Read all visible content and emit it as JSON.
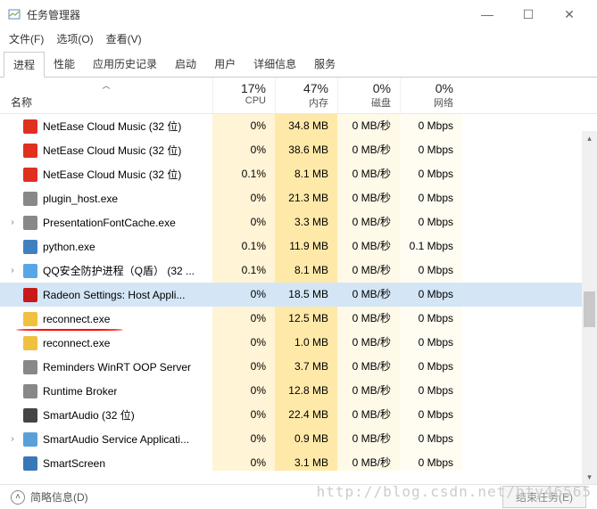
{
  "window": {
    "title": "任务管理器",
    "controls": {
      "min": "—",
      "max": "☐",
      "close": "✕"
    }
  },
  "menu": {
    "file": "文件(F)",
    "options": "选项(O)",
    "view": "查看(V)"
  },
  "tabs": {
    "processes": "进程",
    "performance": "性能",
    "history": "应用历史记录",
    "startup": "启动",
    "users": "用户",
    "details": "详细信息",
    "services": "服务"
  },
  "headers": {
    "name": "名称",
    "cpu_pct": "17%",
    "cpu_lbl": "CPU",
    "mem_pct": "47%",
    "mem_lbl": "内存",
    "disk_pct": "0%",
    "disk_lbl": "磁盘",
    "net_pct": "0%",
    "net_lbl": "网络"
  },
  "rows": [
    {
      "name": "NetEase Cloud Music (32 位)",
      "cpu": "0%",
      "mem": "34.8 MB",
      "disk": "0 MB/秒",
      "net": "0 Mbps",
      "icon": "#e03020",
      "exp": false
    },
    {
      "name": "NetEase Cloud Music (32 位)",
      "cpu": "0%",
      "mem": "38.6 MB",
      "disk": "0 MB/秒",
      "net": "0 Mbps",
      "icon": "#e03020",
      "exp": false
    },
    {
      "name": "NetEase Cloud Music (32 位)",
      "cpu": "0.1%",
      "mem": "8.1 MB",
      "disk": "0 MB/秒",
      "net": "0 Mbps",
      "icon": "#e03020",
      "exp": false
    },
    {
      "name": "plugin_host.exe",
      "cpu": "0%",
      "mem": "21.3 MB",
      "disk": "0 MB/秒",
      "net": "0 Mbps",
      "icon": "#888",
      "exp": false
    },
    {
      "name": "PresentationFontCache.exe",
      "cpu": "0%",
      "mem": "3.3 MB",
      "disk": "0 MB/秒",
      "net": "0 Mbps",
      "icon": "#888",
      "exp": true
    },
    {
      "name": "python.exe",
      "cpu": "0.1%",
      "mem": "11.9 MB",
      "disk": "0 MB/秒",
      "net": "0.1 Mbps",
      "icon": "#4080c0",
      "exp": false
    },
    {
      "name": "QQ安全防护进程（Q盾） (32 ...",
      "cpu": "0.1%",
      "mem": "8.1 MB",
      "disk": "0 MB/秒",
      "net": "0 Mbps",
      "icon": "#58a6e8",
      "exp": true
    },
    {
      "name": "Radeon Settings: Host Appli...",
      "cpu": "0%",
      "mem": "18.5 MB",
      "disk": "0 MB/秒",
      "net": "0 Mbps",
      "icon": "#c81a1a",
      "exp": false,
      "selected": true
    },
    {
      "name": "reconnect.exe",
      "cpu": "0%",
      "mem": "12.5 MB",
      "disk": "0 MB/秒",
      "net": "0 Mbps",
      "icon": "#f0c040",
      "exp": false
    },
    {
      "name": "reconnect.exe",
      "cpu": "0%",
      "mem": "1.0 MB",
      "disk": "0 MB/秒",
      "net": "0 Mbps",
      "icon": "#f0c040",
      "exp": false
    },
    {
      "name": "Reminders WinRT OOP Server",
      "cpu": "0%",
      "mem": "3.7 MB",
      "disk": "0 MB/秒",
      "net": "0 Mbps",
      "icon": "#888",
      "exp": false
    },
    {
      "name": "Runtime Broker",
      "cpu": "0%",
      "mem": "12.8 MB",
      "disk": "0 MB/秒",
      "net": "0 Mbps",
      "icon": "#888",
      "exp": false
    },
    {
      "name": "SmartAudio (32 位)",
      "cpu": "0%",
      "mem": "22.4 MB",
      "disk": "0 MB/秒",
      "net": "0 Mbps",
      "icon": "#444",
      "exp": false
    },
    {
      "name": "SmartAudio Service Applicati...",
      "cpu": "0%",
      "mem": "0.9 MB",
      "disk": "0 MB/秒",
      "net": "0 Mbps",
      "icon": "#5aa0d8",
      "exp": true
    },
    {
      "name": "SmartScreen",
      "cpu": "0%",
      "mem": "3.1 MB",
      "disk": "0 MB/秒",
      "net": "0 Mbps",
      "icon": "#3878b8",
      "exp": false
    }
  ],
  "footer": {
    "brief": "简略信息(D)",
    "end_task": "结束任务(E)"
  },
  "watermark": "http://blog.csdn.net/hty46565"
}
